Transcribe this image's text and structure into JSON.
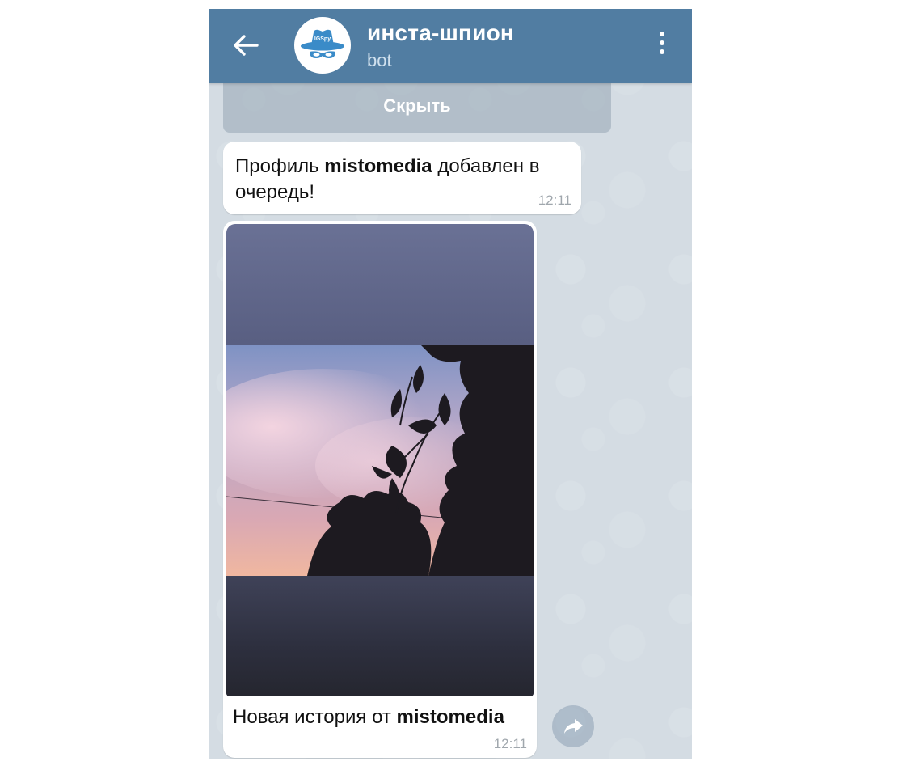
{
  "header": {
    "title": "инста-шпион",
    "subtitle": "bot",
    "avatar_text": "IGSpy",
    "colors": {
      "bar": "#517da2",
      "avatar_icon": "#3a8bc8"
    }
  },
  "keyboard": {
    "hide_button_label": "Скрыть"
  },
  "messages": [
    {
      "text_prefix": "Профиль ",
      "text_bold": "mistomedia",
      "text_suffix": " добавлен в очередь!",
      "time": "12:11"
    },
    {
      "type": "photo",
      "caption_prefix": "Новая история от ",
      "caption_bold": "mistomedia",
      "time": "12:11"
    }
  ],
  "icons": [
    "arrow-left-icon",
    "spy-avatar-icon",
    "more-vertical-icon",
    "share-arrow-icon"
  ]
}
